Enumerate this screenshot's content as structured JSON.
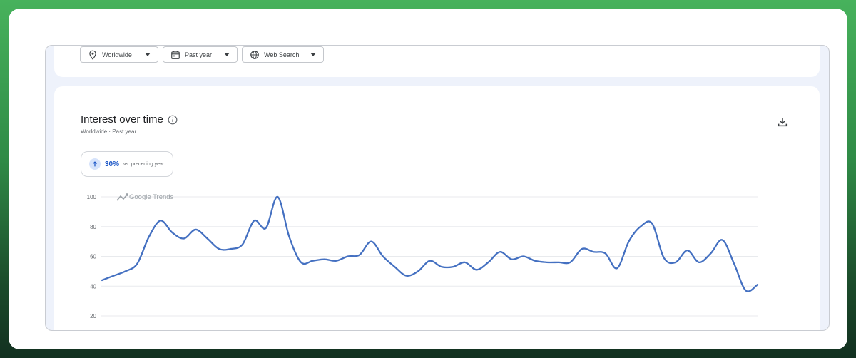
{
  "filters": {
    "location": "Worldwide",
    "time_range": "Past year",
    "search_type": "Web Search"
  },
  "card": {
    "title": "Interest over time",
    "subtitle": "Worldwide · Past year"
  },
  "badge": {
    "percent": "30%",
    "text": "vs. preceding year"
  },
  "watermark": "Google Trends",
  "colors": {
    "line": "#4470c1",
    "accent": "#1a55c6",
    "grid": "#e8eaed"
  },
  "chart_data": {
    "type": "line",
    "title": "Interest over time",
    "ylim": [
      20,
      100
    ],
    "yticks": [
      100,
      80,
      60,
      40,
      20
    ],
    "grid": true,
    "series": [
      {
        "values": [
          44,
          47,
          50,
          55,
          73,
          84,
          76,
          72,
          78,
          72,
          65,
          65,
          68,
          84,
          79,
          100,
          73,
          56,
          57,
          58,
          57,
          60,
          61,
          70,
          60,
          53,
          47,
          50,
          57,
          53,
          53,
          56,
          51,
          56,
          63,
          58,
          60,
          57,
          56,
          56,
          56,
          65,
          63,
          62,
          52,
          70,
          80,
          82,
          59,
          56,
          64,
          56,
          62,
          71,
          55,
          37,
          41
        ]
      }
    ]
  }
}
